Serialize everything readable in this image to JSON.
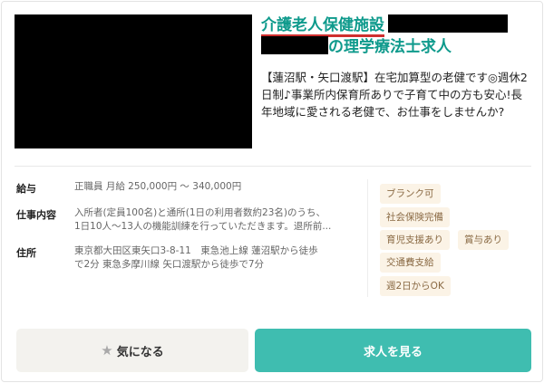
{
  "title": {
    "facility": "介護老人保健施設",
    "rest": "の理学療法士求人"
  },
  "description": "【蓮沼駅・矢口渡駅】在宅加算型の老健です◎週休2日制♪事業所内保育所ありで子育て中の方も安心!長年地域に愛される老健で、お仕事をしませんか?",
  "info": {
    "salary_label": "給与",
    "salary_value": "正職員 月給 250,000円 〜 340,000円",
    "job_label": "仕事内容",
    "job_value_1": "入所者(定員100名)と通所(1日の利用者数約23名)のうち、",
    "job_value_2": "1日10人〜13人の機能訓練を行っていただきます。退所前...",
    "address_label": "住所",
    "address_value_1": "東京都大田区東矢口3-8-11　東急池上線 蓮沼駅から徒歩",
    "address_value_2": "で2分 東急多摩川線 矢口渡駅から徒歩で7分"
  },
  "tags": [
    "ブランク可",
    "社会保険完備",
    "育児支援あり",
    "賞与あり",
    "交通費支給",
    "週2日からOK"
  ],
  "buttons": {
    "favorite_label": "気になる",
    "favorite_icon": "star-icon",
    "view_label": "求人を見る"
  },
  "colors": {
    "accent": "#0e9a8c",
    "button_primary": "#3fbdb0",
    "tag_bg": "#fbf3e6"
  }
}
